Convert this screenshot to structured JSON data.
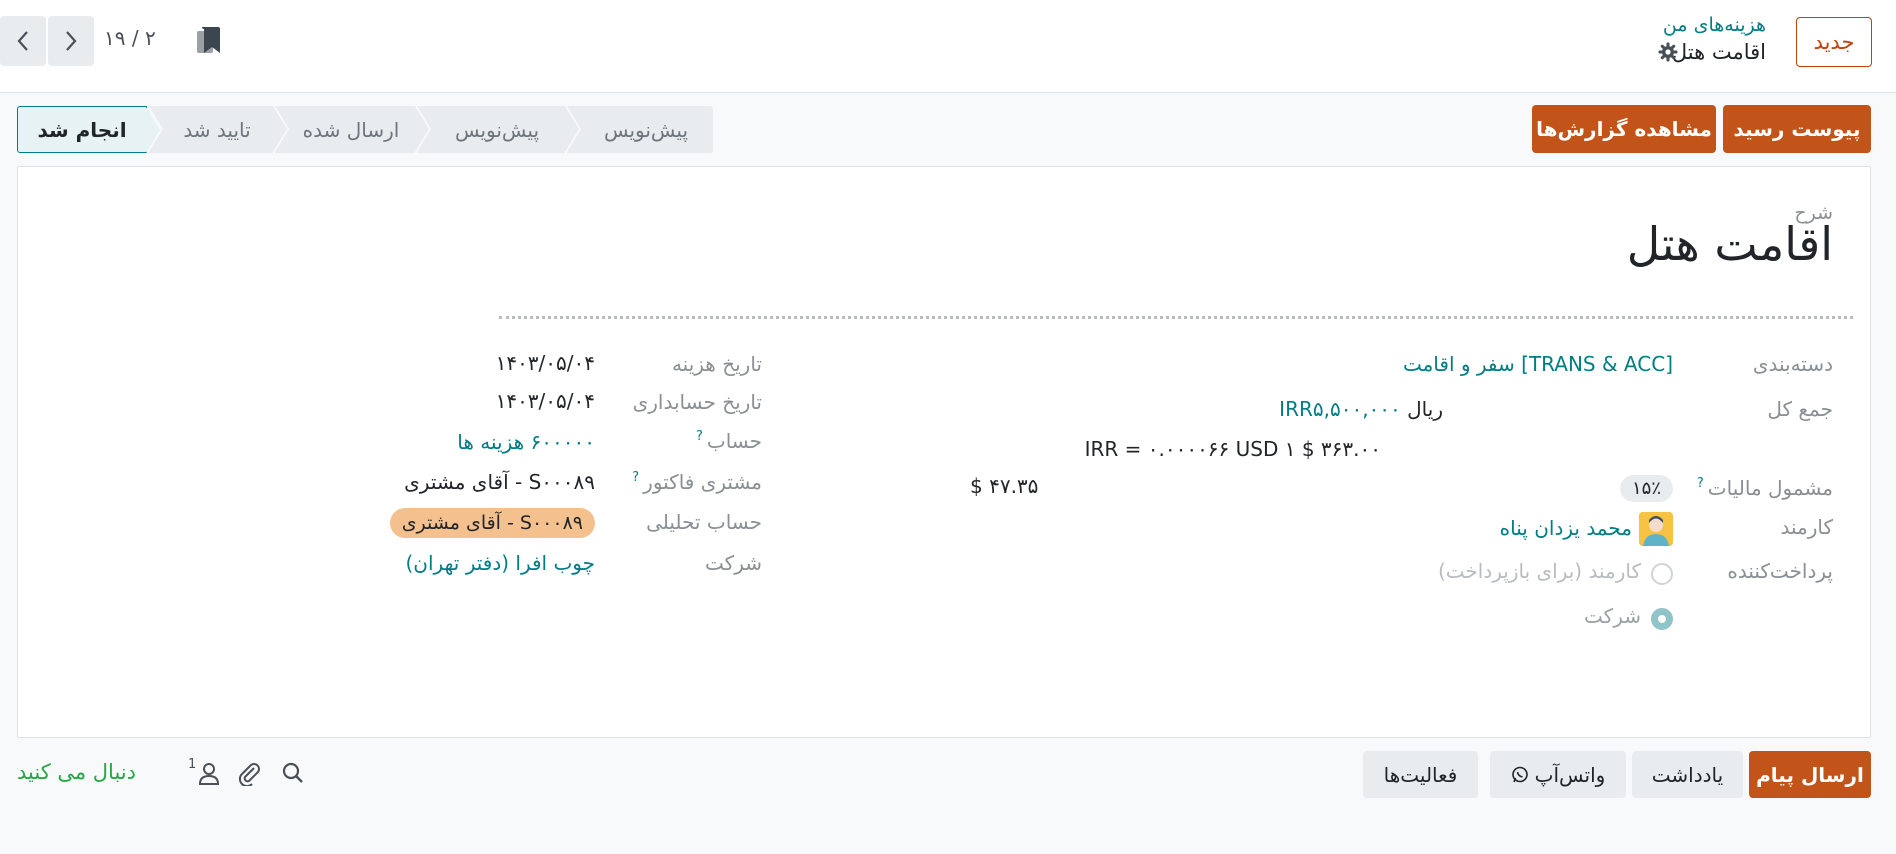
{
  "header": {
    "pager_value": "۲ / ۱۹",
    "new_button": "جدید",
    "breadcrumb_parent": "هزینه‌های من",
    "breadcrumb_current": "اقامت هتل"
  },
  "actions": {
    "attach_receipt": "پیوست رسید",
    "view_reports": "مشاهده گزارش‌ها"
  },
  "status_stages": [
    {
      "label": "پیش‌نویس",
      "active": false
    },
    {
      "label": "پیش‌نویس",
      "active": false
    },
    {
      "label": "ارسال شده",
      "active": false
    },
    {
      "label": "تایید شد",
      "active": false
    },
    {
      "label": "انجام شد",
      "active": true
    }
  ],
  "form": {
    "description_label": "شرح",
    "description_value": "اقامت هتل",
    "right": {
      "category_label": "دسته‌بندی",
      "category_value": "[TRANS & ACC] سفر و اقامت",
      "total_label": "جمع کل",
      "total_value": "ریال",
      "total_currency_value": "IRR۵,۵۰۰,۰۰۰",
      "conversion_text": "IRR = ۰.۰۰۰۰۶۶ USD ۱ $ ۳۶۳.۰۰",
      "tax_label": "مشمول مالیات",
      "tax_help": "?",
      "tax_value": "۱۵٪",
      "tax_amount": "$ ۴۷.۳۵",
      "employee_label": "کارمند",
      "employee_value": "محمد یزدان پناه",
      "paid_by_label": "پرداخت‌کننده",
      "paid_by_options": [
        {
          "label": "کارمند (برای بازپرداخت)",
          "checked": false
        },
        {
          "label": "شرکت",
          "checked": true
        }
      ]
    },
    "left": {
      "expense_date_label": "تاریخ هزینه",
      "expense_date_value": "۱۴۰۳/۰۵/۰۴",
      "accounting_date_label": "تاریخ حسابداری",
      "accounting_date_value": "۱۴۰۳/۰۵/۰۴",
      "account_label": "حساب",
      "account_help": "?",
      "account_value": "۶۰۰۰۰۰ هزینه ها",
      "customer_label": "مشتری فاکتور",
      "customer_help": "?",
      "customer_value": "S۰۰۰۸۹ - آقای مشتری",
      "analytic_label": "حساب تحلیلی",
      "analytic_value": "S۰۰۰۸۹ - آقای مشتری",
      "company_label": "شرکت",
      "company_value": "چوب افرا (دفتر تهران)"
    }
  },
  "chatter": {
    "send_message": "ارسال پیام",
    "log_note": "یادداشت",
    "whatsapp": "واتس‌آپ",
    "activities": "فعالیت‌ها",
    "follower_count": "1",
    "following": "دنبال می کنید"
  },
  "colors": {
    "primary": "#c2541a",
    "link": "#017e84",
    "following": "#28a745",
    "tag": "#f4c08e"
  },
  "icons": {
    "prev": "chevron-left-icon",
    "next": "chevron-right-icon",
    "bookmark": "bookmark-icon",
    "settings": "gear-icon",
    "whatsapp": "whatsapp-icon",
    "search": "search-icon",
    "attachment": "paperclip-icon",
    "followers": "user-icon"
  }
}
